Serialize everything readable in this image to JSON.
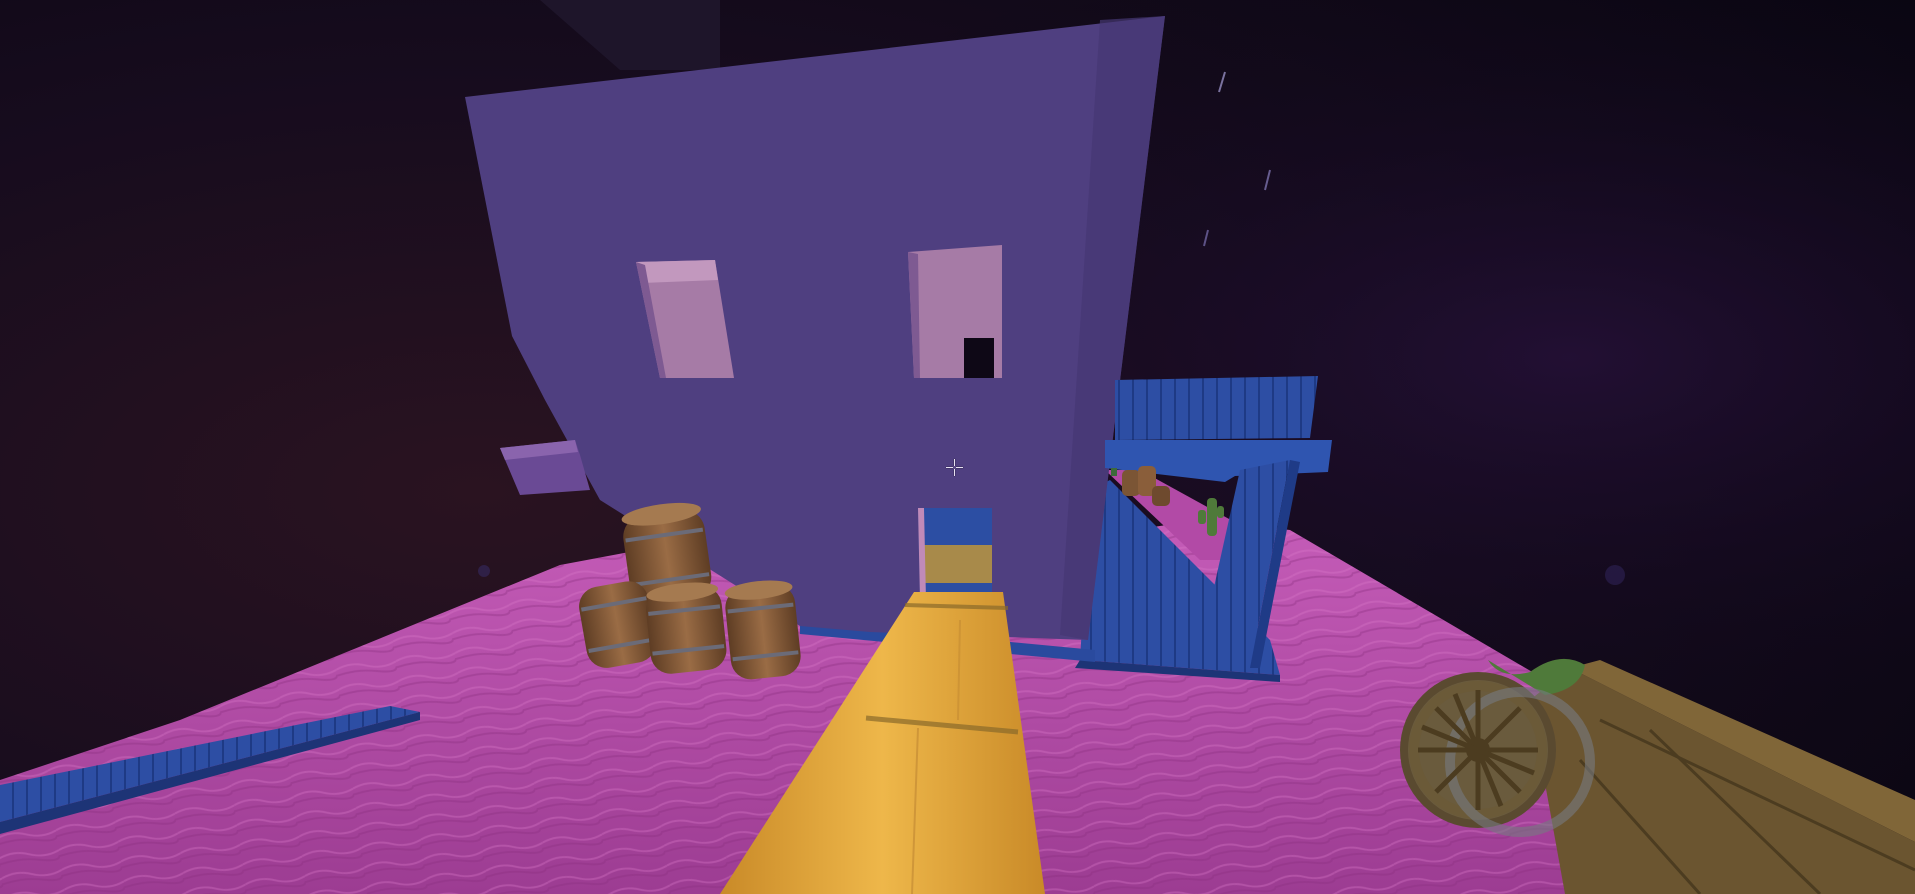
{
  "scene": {
    "colors": {
      "sky": "#120a1c",
      "ground": "#b24aa6",
      "building_wall": "#4f3f80",
      "building_side": "#6a4a95",
      "window_inner": "#a67ba6",
      "porch_blue": "#2c4ea3",
      "hay": "#e0a63c",
      "barrel_wood": "#8a5e3a",
      "wagon_wood": "#6b5530"
    },
    "objects": [
      "building",
      "barrels",
      "hay-path",
      "blue-porch",
      "wagon-wheel",
      "wagon",
      "cactus",
      "distant-barrels",
      "blue-plank"
    ]
  },
  "hud": {
    "crosshair_icon": "crosshair-icon"
  }
}
